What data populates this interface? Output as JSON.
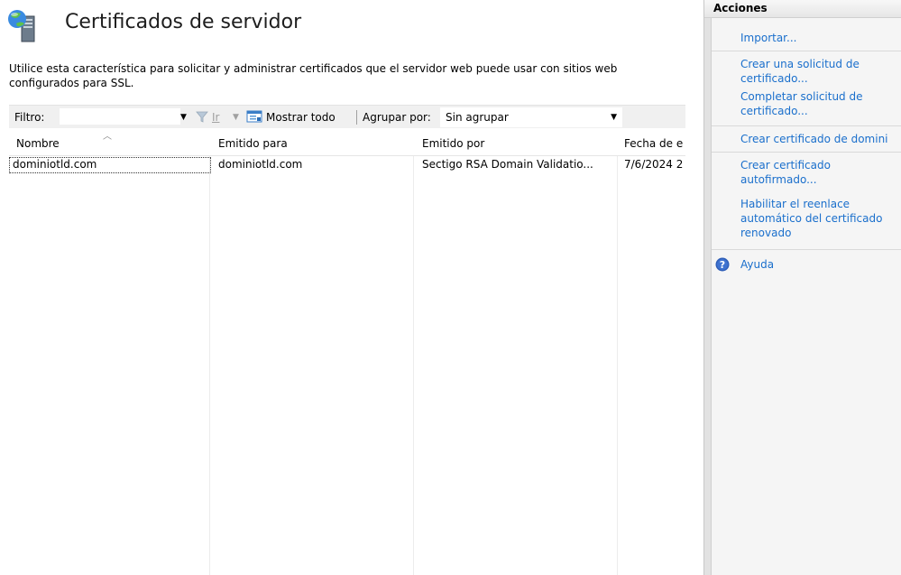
{
  "header": {
    "title": "Certificados de servidor",
    "description": "Utilice esta característica para solicitar y administrar certificados que el servidor web puede usar con sitios web configurados para SSL."
  },
  "toolbar": {
    "filter_label": "Filtro:",
    "filter_value": "",
    "go_label": "Ir",
    "show_all_label": "Mostrar todo",
    "group_by_label": "Agrupar por:",
    "group_by_value": "Sin agrupar"
  },
  "table": {
    "columns": [
      "Nombre",
      "Emitido para",
      "Emitido por",
      "Fecha de e"
    ],
    "rows": [
      [
        "dominiotld.com",
        "dominiotld.com",
        "Sectigo RSA Domain Validatio...",
        "7/6/2024 2"
      ]
    ]
  },
  "actions": {
    "title": "Acciones",
    "items": [
      "Importar...",
      "Crear una solicitud de\ncertificado...",
      "Completar solicitud de\ncertificado...",
      "Crear certificado de domini",
      "Crear certificado\nautofirmado...",
      "Habilitar el reenlace\nautomático del certificado\nrenovado",
      "Ayuda"
    ]
  },
  "colors": {
    "link": "#1a6fcc",
    "pane_bg": "#f5f5f5",
    "toolbar_bg": "#f0f0f0"
  },
  "icons": {
    "header": "server-certificate-icon",
    "go": "filter-go-icon",
    "show_all": "show-all-icon",
    "help": "help-icon"
  }
}
